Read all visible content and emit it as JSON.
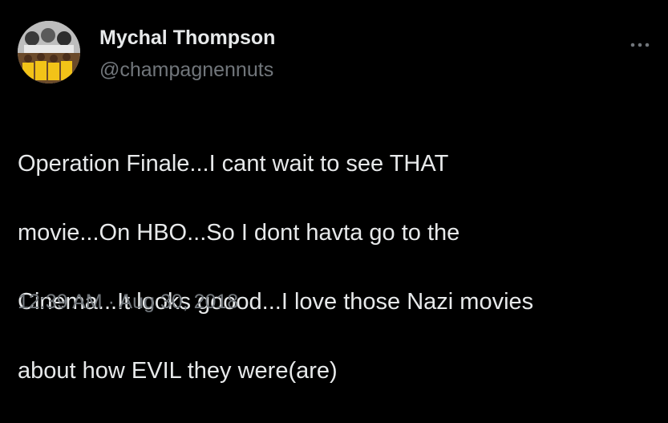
{
  "user": {
    "name": "Mychal Thompson",
    "handle": "@champagnennuts"
  },
  "tweet": {
    "lines": [
      "Operation Finale...I cant wait to see THAT",
      "movie...On HBO...So I dont havta go to the",
      "Cinema...It looks goood...I love those Nazi movies",
      "about how EVIL they were(are)"
    ],
    "timestamp": "12:39 AM · Aug 30, 2018"
  },
  "icons": {
    "avatar": "profile-photo",
    "more": "more-dots-icon"
  },
  "colors": {
    "background": "#000000",
    "primary_text": "#e7e9ea",
    "secondary_text": "#71767b"
  }
}
